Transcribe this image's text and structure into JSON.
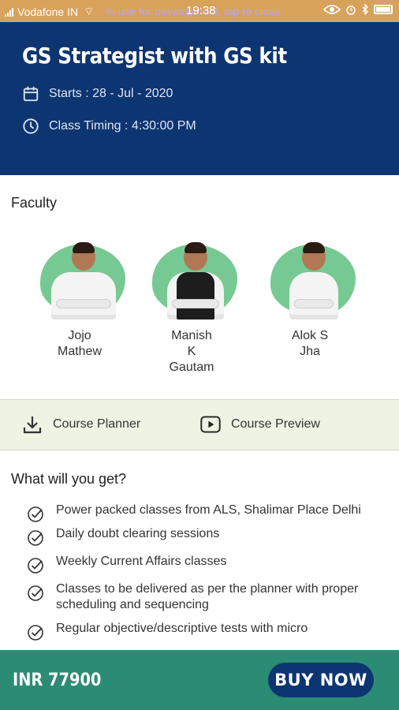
{
  "status_bar": {
    "carrier": "Vodafone IN",
    "notice": "In use for development, tap to close",
    "time": "19:38"
  },
  "course": {
    "title": "GS Strategist with GS kit",
    "starts": "Starts : 28 - Jul - 2020",
    "timing": "Class Timing : 4:30:00 PM"
  },
  "faculty": {
    "heading": "Faculty",
    "members": [
      {
        "name": "Jojo\nMathew"
      },
      {
        "name": "Manish\nK\nGautam"
      },
      {
        "name": "Alok S\nJha"
      }
    ]
  },
  "actions": {
    "planner_label": "Course Planner",
    "preview_label": "Course Preview"
  },
  "benefits": {
    "heading": "What will you get?",
    "items": [
      "Power packed classes from ALS, Shalimar Place Delhi",
      "Daily doubt clearing sessions",
      "Weekly Current Affairs classes",
      "Classes to be delivered as per the planner with proper scheduling and sequencing",
      "Regular objective/descriptive tests with micro"
    ]
  },
  "footer": {
    "price": "INR 77900",
    "buy_label": "BUY NOW"
  },
  "colors": {
    "header_bg": "#0d3572",
    "accent_green": "#2c8b74",
    "status_bar": "#d9a25b",
    "action_bar_bg": "#eef3e4"
  }
}
